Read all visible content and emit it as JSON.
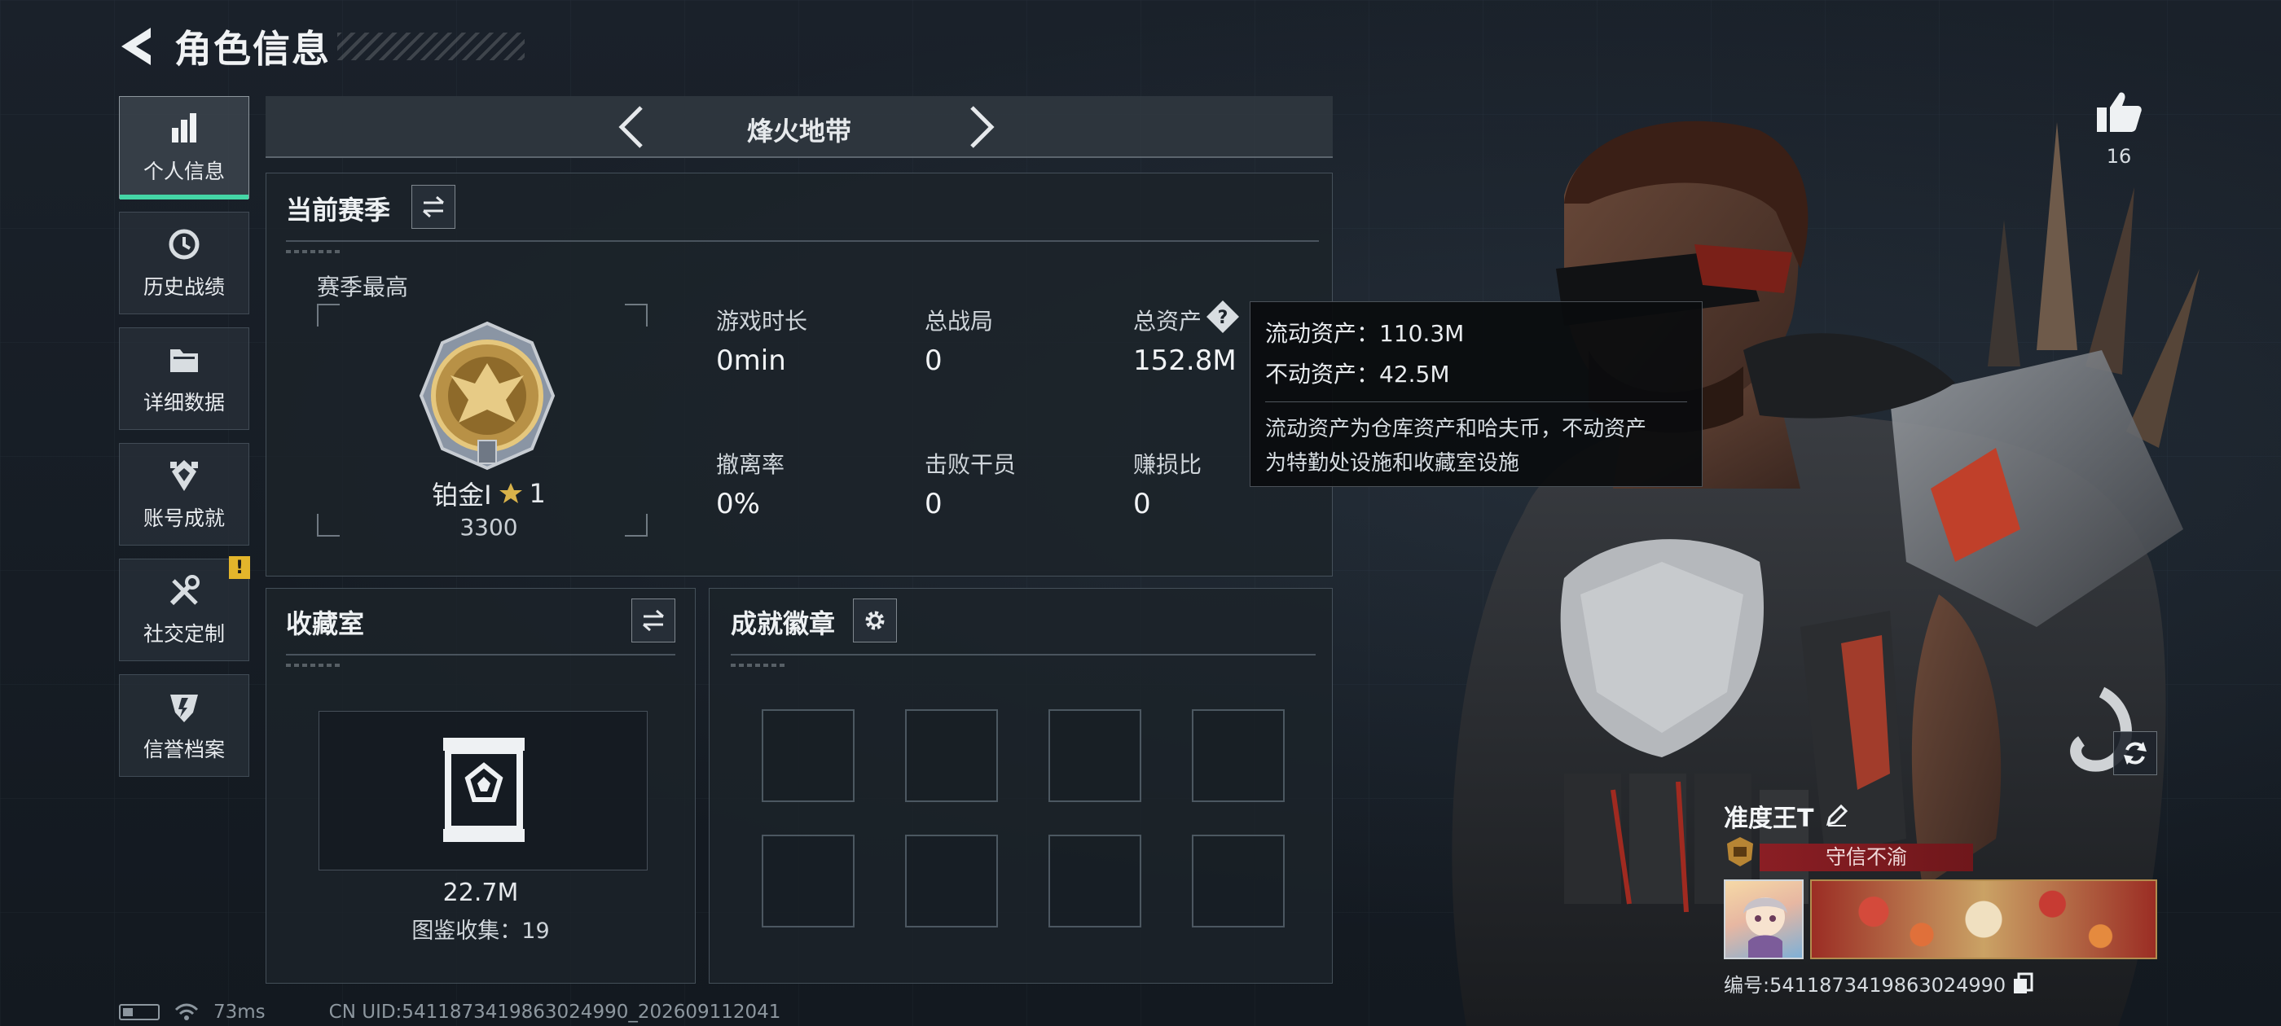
{
  "header": {
    "title": "角色信息"
  },
  "sidebar": {
    "items": [
      {
        "label": "个人信息",
        "icon": "bar-chart-icon",
        "active": true
      },
      {
        "label": "历史战绩",
        "icon": "history-icon"
      },
      {
        "label": "详细数据",
        "icon": "folder-icon"
      },
      {
        "label": "账号成就",
        "icon": "achievement-icon"
      },
      {
        "label": "社交定制",
        "icon": "tools-icon",
        "badge": "!"
      },
      {
        "label": "信誉档案",
        "icon": "shield-icon"
      }
    ]
  },
  "mode_tab": {
    "title": "烽火地带"
  },
  "season": {
    "title": "当前赛季",
    "best_label": "赛季最高",
    "rank_name": "铂金I",
    "rank_stars": "1",
    "rank_points": "3300",
    "stats": [
      {
        "label": "游戏时长",
        "value": "0min"
      },
      {
        "label": "总战局",
        "value": "0"
      },
      {
        "label": "总资产",
        "value": "152.8M"
      },
      {
        "label": "撤离率",
        "value": "0%"
      },
      {
        "label": "击败干员",
        "value": "0"
      },
      {
        "label": "赚损比",
        "value": "0"
      }
    ]
  },
  "tooltip": {
    "liquid": "流动资产：110.3M",
    "fixed": "不动资产：42.5M",
    "desc_line1": "流动资产为仓库资产和哈夫币，不动资产",
    "desc_line2": "为特勤处设施和收藏室设施"
  },
  "collection": {
    "title": "收藏室",
    "value": "22.7M",
    "catalog": "图鉴收集：19"
  },
  "achievements": {
    "title": "成就徽章"
  },
  "player": {
    "likes": "16",
    "name": "准度王T",
    "title_badge": "守信不渝",
    "id": "编号:5411873419863024990"
  },
  "status": {
    "ping": "73ms",
    "uid": "CN UID:5411873419863024990_202609112041"
  },
  "colors": {
    "accent": "#44d6a6",
    "warning": "#e3b52b",
    "title_red": "#8a1e24"
  }
}
